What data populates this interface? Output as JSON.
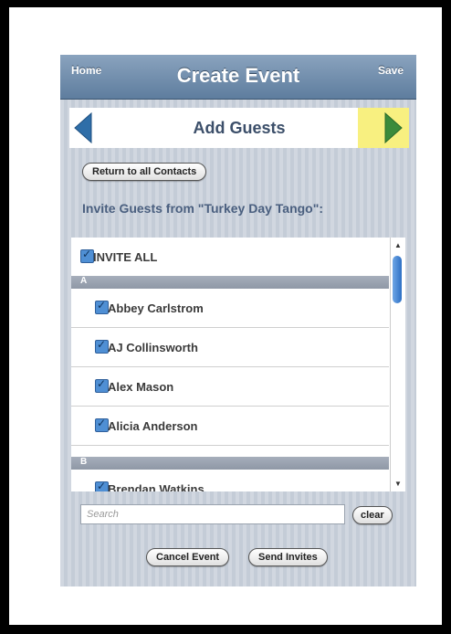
{
  "navbar": {
    "home_label": "Home",
    "title": "Create Event",
    "save_label": "Save"
  },
  "subbar": {
    "title": "Add Guests"
  },
  "return_button": "Return to all Contacts",
  "invite_heading": "Invite Guests from \"Turkey Day Tango\":",
  "list": {
    "invite_all": "INVITE ALL",
    "sections": [
      {
        "letter": "A",
        "contacts": [
          "Abbey Carlstrom",
          "AJ Collinsworth",
          "Alex Mason",
          "Alicia Anderson"
        ]
      },
      {
        "letter": "B",
        "contacts": [
          "Brendan Watkins"
        ]
      }
    ]
  },
  "search": {
    "placeholder": "Search",
    "clear_label": "clear"
  },
  "footer": {
    "cancel_label": "Cancel Event",
    "send_label": "Send Invites"
  },
  "colors": {
    "navbar": "#6f8cab",
    "accent": "#2d6fc4",
    "highlight": "#f8f080",
    "arrow": "#3b8b3b",
    "left_arrow": "#2f6ea8"
  },
  "icons": {
    "left": "left-arrow-icon",
    "right": "right-arrow-icon"
  }
}
